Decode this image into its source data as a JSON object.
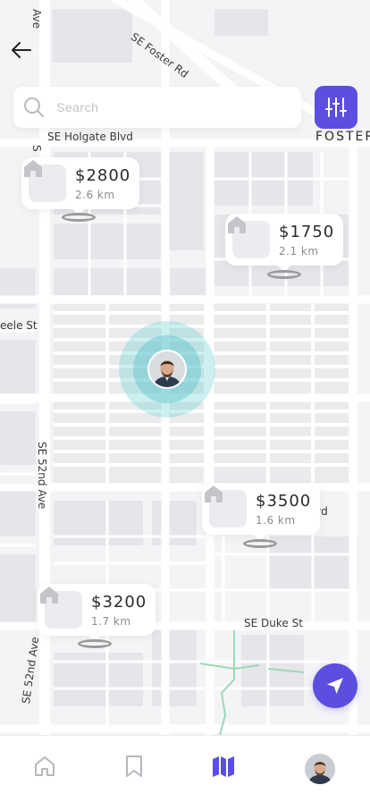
{
  "search": {
    "placeholder": "Search"
  },
  "map": {
    "labels": {
      "foster_rd": "SE Foster Rd",
      "foster_edge": "FOSTER",
      "holgate": "SE Holgate Blvd",
      "steele": "eele St",
      "fifty_second_a": "SE 52nd Ave",
      "fifty_second_b": "SE 52nd Ave",
      "duke": "SE Duke St",
      "top_ave": "Ave",
      "left_s": "S",
      "vd": "vd"
    }
  },
  "listings": [
    {
      "price": "$2800",
      "distance": "2.6 km"
    },
    {
      "price": "$1750",
      "distance": "2.1 km"
    },
    {
      "price": "$3500",
      "distance": "1.6 km"
    },
    {
      "price": "$3200",
      "distance": "1.7 km"
    }
  ],
  "colors": {
    "accent": "#5b4ee0",
    "location_halo": "#56c9cd",
    "map_road": "#ffffff",
    "map_block": "#e7e7ea"
  },
  "icons": [
    "back-arrow-icon",
    "search-icon",
    "filter-sliders-icon",
    "house-icon",
    "navigation-arrow-icon",
    "home-icon",
    "bookmark-icon",
    "map-icon"
  ]
}
